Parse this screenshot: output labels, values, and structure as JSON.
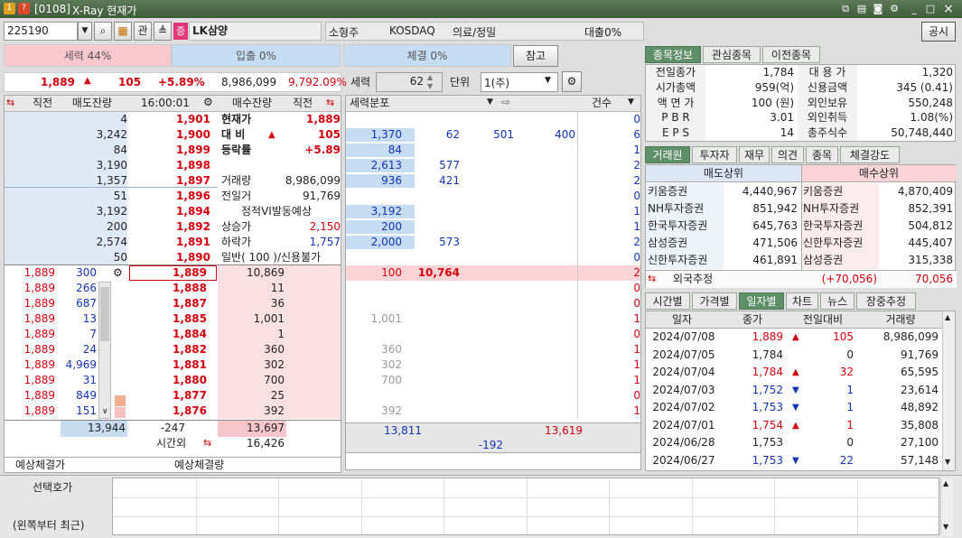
{
  "window": {
    "app_badge": "1",
    "help_badge": "?",
    "code": "[0108]",
    "title": "X-Ray 현재가",
    "min": "_",
    "close": "×"
  },
  "toolbar": {
    "stock_code": "225190",
    "badge_gwan": "관",
    "badge_jeung": "증",
    "stock_name": "LK삼양",
    "market_cap_class": "소형주",
    "market": "KOSDAQ",
    "sector": "의료/정밀",
    "loan": "대출0%",
    "notice_button": "공시"
  },
  "power_bar": {
    "seryuk": "세력 44%",
    "ipchul": "입출 0%",
    "chegyeol": "체결 0%",
    "reference_button": "참고"
  },
  "price_line": {
    "price": "1,889",
    "change": "105",
    "rate": "+5.89%",
    "volume": "8,986,099",
    "turnover": "9,792.09%"
  },
  "dist_controls": {
    "seryuk_label": "세력",
    "seryuk_value": "62",
    "unit_label": "단위",
    "unit_value": "1(주)"
  },
  "orderbook": {
    "headers": {
      "prev": "직전",
      "sell": "매도잔량",
      "time": "16:00:01",
      "buy": "매수잔량",
      "prev2": "직전"
    },
    "asks": [
      {
        "qty": "4",
        "price": "1,901"
      },
      {
        "qty": "3,242",
        "price": "1,900"
      },
      {
        "qty": "84",
        "price": "1,899"
      },
      {
        "qty": "3,190",
        "price": "1,898"
      },
      {
        "qty": "1,357",
        "price": "1,897"
      },
      {
        "qty": "51",
        "price": "1,896"
      },
      {
        "qty": "3,192",
        "price": "1,894"
      },
      {
        "qty": "200",
        "price": "1,892"
      },
      {
        "qty": "2,574",
        "price": "1,891"
      },
      {
        "qty": "50",
        "price": "1,890"
      }
    ],
    "info": [
      {
        "label": "현재가",
        "value": "1,889"
      },
      {
        "label": "대 비",
        "arrow": "▲",
        "value": "105"
      },
      {
        "label": "등락률",
        "value": "+5.89"
      },
      {
        "label": "",
        "value": ""
      },
      {
        "label": "거래량",
        "value": "8,986,099"
      },
      {
        "label": "전일거",
        "value": "91,769"
      },
      {
        "label": "정적VI발동예상",
        "value": ""
      },
      {
        "label": "상승가",
        "value": "2,150"
      },
      {
        "label": "하락가",
        "value": "1,757"
      },
      {
        "label": "일반( 100 )/신용불가",
        "value": ""
      }
    ],
    "bids": [
      {
        "qty": "10,869",
        "price": "1,889"
      },
      {
        "qty": "11",
        "price": "1,888"
      },
      {
        "qty": "36",
        "price": "1,887"
      },
      {
        "qty": "1,001",
        "price": "1,885"
      },
      {
        "qty": "1",
        "price": "1,884"
      },
      {
        "qty": "360",
        "price": "1,882"
      },
      {
        "qty": "302",
        "price": "1,881"
      },
      {
        "qty": "700",
        "price": "1,880"
      },
      {
        "qty": "25",
        "price": "1,877"
      },
      {
        "qty": "392",
        "price": "1,876"
      }
    ],
    "ticks": [
      {
        "p": "1,889",
        "q": "300"
      },
      {
        "p": "1,889",
        "q": "266"
      },
      {
        "p": "1,889",
        "q": "687"
      },
      {
        "p": "1,889",
        "q": "13"
      },
      {
        "p": "1,889",
        "q": "7"
      },
      {
        "p": "1,889",
        "q": "24"
      },
      {
        "p": "1,889",
        "q": "4,969"
      },
      {
        "p": "1,889",
        "q": "31"
      },
      {
        "p": "1,889",
        "q": "849"
      },
      {
        "p": "1,889",
        "q": "151"
      }
    ],
    "total_sell": "13,944",
    "diff": "-247",
    "total_buy": "13,697",
    "after_hours_label": "시간외",
    "after_hours": "16,426",
    "expected_price_label": "예상체결가",
    "expected_vol_label": "예상체결량"
  },
  "distribution": {
    "header_label": "세력분포",
    "count_label": "건수",
    "rows": [
      {
        "a": "",
        "b": "",
        "c": "",
        "d": "",
        "n": "0"
      },
      {
        "a": "1,370",
        "b": "62",
        "c": "501",
        "d": "400",
        "n": "6"
      },
      {
        "a": "84",
        "b": "",
        "c": "",
        "d": "",
        "n": "1"
      },
      {
        "a": "2,613",
        "b": "577",
        "c": "",
        "d": "",
        "n": "2"
      },
      {
        "a": "936",
        "b": "421",
        "c": "",
        "d": "",
        "n": "2"
      },
      {
        "a": "",
        "b": "",
        "c": "",
        "d": "",
        "n": "0"
      },
      {
        "a": "3,192",
        "b": "",
        "c": "",
        "d": "",
        "n": "1"
      },
      {
        "a": "200",
        "b": "",
        "c": "",
        "d": "",
        "n": "1"
      },
      {
        "a": "2,000",
        "b": "573",
        "c": "",
        "d": "",
        "n": "2"
      },
      {
        "a": "",
        "b": "",
        "c": "",
        "d": "",
        "n": "0"
      },
      {
        "a": "100",
        "b": "10,764",
        "c": "",
        "d": "",
        "n": "2"
      },
      {
        "a": "",
        "b": "",
        "c": "",
        "d": "",
        "n": "0"
      },
      {
        "a": "",
        "b": "",
        "c": "",
        "d": "",
        "n": "0"
      },
      {
        "a": "1,001",
        "b": "",
        "c": "",
        "d": "",
        "n": "1"
      },
      {
        "a": "",
        "b": "",
        "c": "",
        "d": "",
        "n": "0"
      },
      {
        "a": "360",
        "b": "",
        "c": "",
        "d": "",
        "n": "1"
      },
      {
        "a": "302",
        "b": "",
        "c": "",
        "d": "",
        "n": "1"
      },
      {
        "a": "700",
        "b": "",
        "c": "",
        "d": "",
        "n": "1"
      },
      {
        "a": "",
        "b": "",
        "c": "",
        "d": "",
        "n": "0"
      },
      {
        "a": "392",
        "b": "",
        "c": "",
        "d": "",
        "n": "1"
      }
    ],
    "sum_sell": "13,811",
    "sum_buy": "13,619",
    "sum_diff": "-192"
  },
  "stock_info": {
    "tabs": [
      "종목정보",
      "관심종목",
      "이전종목"
    ],
    "rows": [
      {
        "l1": "전일종가",
        "v1": "1,784",
        "l2": "대 용 가",
        "v2": "1,320"
      },
      {
        "l1": "시가총액",
        "v1": "959(억)",
        "l2": "신용금액",
        "v2": "345  (0.41)"
      },
      {
        "l1": "액 면 가",
        "v1": "100 (원)",
        "l2": "외인보유",
        "v2": "550,248"
      },
      {
        "l1": "P B R",
        "v1": "3.01",
        "l2": "외인취득",
        "v2": "1.08(%)"
      },
      {
        "l1": "E P S",
        "v1": "14",
        "l2": "총주식수",
        "v2": "50,748,440"
      }
    ]
  },
  "broker": {
    "tabs": [
      "거래원",
      "투자자",
      "재무",
      "의견",
      "종목",
      "체결강도"
    ],
    "sell_header": "매도상위",
    "buy_header": "매수상위",
    "rows": [
      {
        "sn": "키움증권",
        "sv": "4,440,967",
        "bn": "키움증권",
        "bv": "4,870,409"
      },
      {
        "sn": "NH투자증권",
        "sv": "851,942",
        "bn": "NH투자증권",
        "bv": "852,391"
      },
      {
        "sn": "한국투자증권",
        "sv": "645,763",
        "bn": "한국투자증권",
        "bv": "504,812"
      },
      {
        "sn": "삼성증권",
        "sv": "471,506",
        "bn": "신한투자증권",
        "bv": "445,407"
      },
      {
        "sn": "신한투자증권",
        "sv": "461,891",
        "bn": "삼성증권",
        "bv": "315,338"
      }
    ],
    "foreign_label": "외국추정",
    "foreign_diff": "(+70,056)",
    "foreign_value": "70,056"
  },
  "daily": {
    "tabs": [
      "시간별",
      "가격별",
      "일자별",
      "차트",
      "뉴스",
      "장중추정"
    ],
    "headers": [
      "일자",
      "종가",
      "전일대비",
      "거래량"
    ],
    "rows": [
      {
        "date": "2024/07/08",
        "close": "1,889",
        "dir": "up",
        "chg": "105",
        "vol": "8,986,099"
      },
      {
        "date": "2024/07/05",
        "close": "1,784",
        "dir": "flat",
        "chg": "0",
        "vol": "91,769"
      },
      {
        "date": "2024/07/04",
        "close": "1,784",
        "dir": "up",
        "chg": "32",
        "vol": "65,595"
      },
      {
        "date": "2024/07/03",
        "close": "1,752",
        "dir": "down",
        "chg": "1",
        "vol": "23,614"
      },
      {
        "date": "2024/07/02",
        "close": "1,753",
        "dir": "down",
        "chg": "1",
        "vol": "48,892"
      },
      {
        "date": "2024/07/01",
        "close": "1,754",
        "dir": "up",
        "chg": "1",
        "vol": "35,808"
      },
      {
        "date": "2024/06/28",
        "close": "1,753",
        "dir": "flat",
        "chg": "0",
        "vol": "27,100"
      },
      {
        "date": "2024/06/27",
        "close": "1,753",
        "dir": "down",
        "chg": "22",
        "vol": "57,148"
      }
    ]
  },
  "bottom": {
    "select_label": "선택호가",
    "recent_label": "(왼쪽부터 최근)"
  }
}
